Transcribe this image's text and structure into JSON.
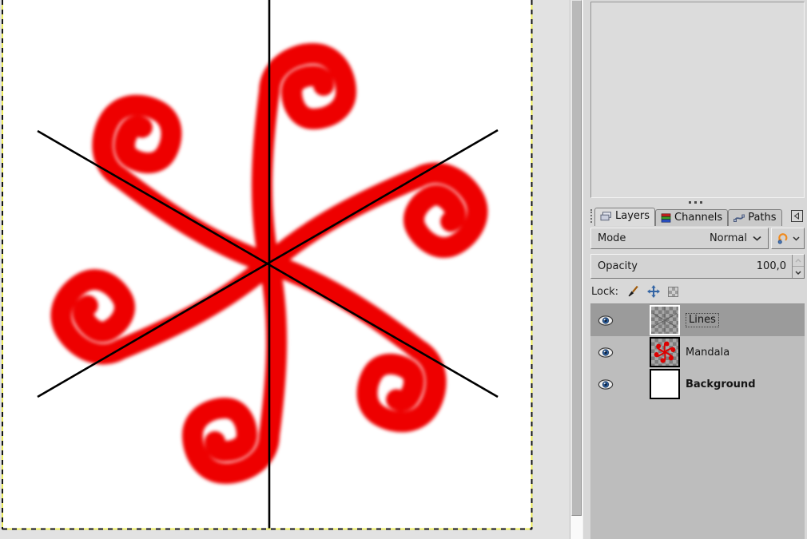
{
  "dock": {
    "tabs": [
      {
        "label": "Layers",
        "active": true
      },
      {
        "label": "Channels",
        "active": false
      },
      {
        "label": "Paths",
        "active": false
      }
    ],
    "mode_label": "Mode",
    "mode_value": "Normal",
    "opacity_label": "Opacity",
    "opacity_value": "100,0",
    "lock_label": "Lock:",
    "layers": [
      {
        "name": "Lines",
        "visible": true,
        "selected": true
      },
      {
        "name": "Mandala",
        "visible": true,
        "selected": false
      },
      {
        "name": "Background",
        "visible": true,
        "selected": false
      }
    ]
  },
  "canvas": {
    "mandala_color": "#ee0000",
    "guide_line_color": "#000000",
    "background_color": "#ffffff",
    "boundary_dash_colors": [
      "#eded5e",
      "#141414"
    ]
  },
  "icons": {
    "tab_icons": [
      "layers-icon",
      "channels-icon",
      "paths-icon"
    ],
    "tab_menu": "left-triangle-icon",
    "mode_aux": "reset-mode-icon",
    "lock_icons": [
      "brush-icon",
      "move-icon",
      "alpha-checker-icon"
    ],
    "visibility": "eye-icon"
  }
}
